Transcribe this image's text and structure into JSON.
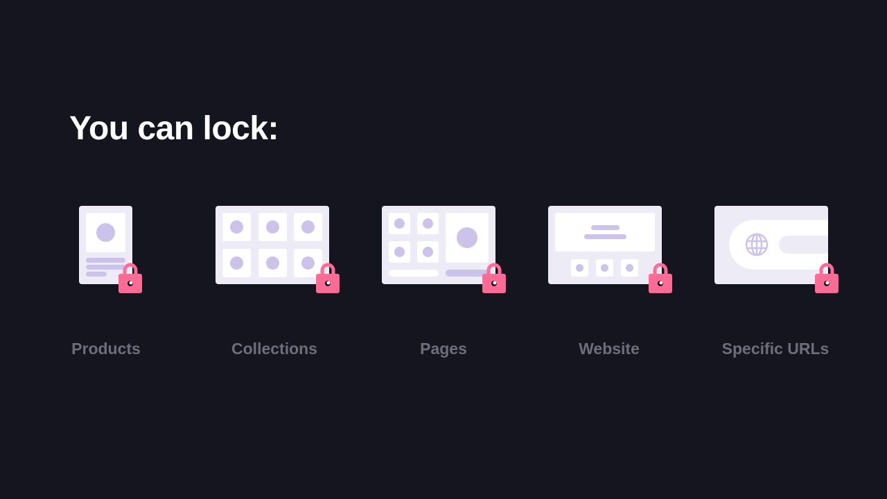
{
  "heading": "You can lock:",
  "items": [
    {
      "label": "Products",
      "icon": "product-page-icon"
    },
    {
      "label": "Collections",
      "icon": "collection-grid-icon"
    },
    {
      "label": "Pages",
      "icon": "page-layout-icon"
    },
    {
      "label": "Website",
      "icon": "website-icon"
    },
    {
      "label": "Specific URLs",
      "icon": "url-bar-icon"
    }
  ],
  "colors": {
    "background": "#15151f",
    "card": "#ecebf6",
    "accent_lock": "#ff6b95",
    "placeholder": "#cbc3ea",
    "label": "#6e6e7a"
  }
}
